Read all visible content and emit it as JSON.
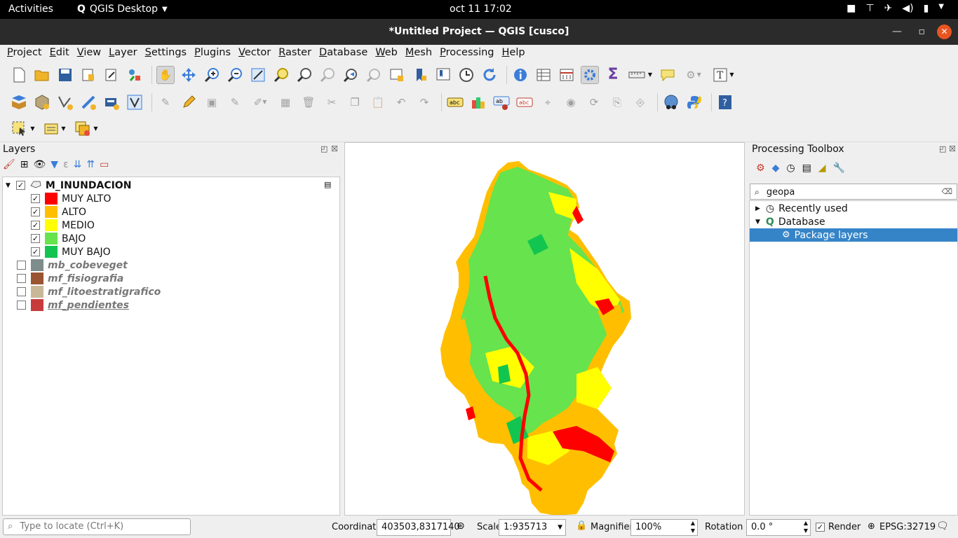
{
  "system": {
    "activities": "Activities",
    "app_name": "QGIS Desktop",
    "clock": "oct 11  17:02"
  },
  "window": {
    "title": "*Untitled Project — QGIS [cusco]"
  },
  "menu": [
    "Project",
    "Edit",
    "View",
    "Layer",
    "Settings",
    "Plugins",
    "Vector",
    "Raster",
    "Database",
    "Web",
    "Mesh",
    "Processing",
    "Help"
  ],
  "layers_panel": {
    "title": "Layers",
    "group": {
      "name": "M_INUNDACION",
      "checked": true
    },
    "classes": [
      {
        "label": "MUY ALTO",
        "color": "#ff0000"
      },
      {
        "label": "ALTO",
        "color": "#ffbf00"
      },
      {
        "label": "MEDIO",
        "color": "#ffff00"
      },
      {
        "label": "BAJO",
        "color": "#66e34d"
      },
      {
        "label": "MUY BAJO",
        "color": "#12c550"
      }
    ],
    "inactive_layers": [
      {
        "label": "mb_cobeveget",
        "color": "#7f8c8c"
      },
      {
        "label": "mf_fisiografia",
        "color": "#9a5432"
      },
      {
        "label": "mf_litoestratigrafico",
        "color": "#c9b898"
      },
      {
        "label": "mf_pendientes",
        "color": "#c83b3b"
      }
    ]
  },
  "processing": {
    "title": "Processing Toolbox",
    "search_value": "geopa",
    "tree": [
      {
        "label": "Recently used",
        "expanded": false
      },
      {
        "label": "Database",
        "expanded": true
      },
      {
        "label": "Package layers",
        "selected": true
      }
    ]
  },
  "status": {
    "locate_placeholder": "Type to locate (Ctrl+K)",
    "coordinate_label": "Coordinate",
    "coordinate_value": "403503,8317140",
    "scale_label": "Scale",
    "scale_value": "1:935713",
    "magnifier_label": "Magnifier",
    "magnifier_value": "100%",
    "rotation_label": "Rotation",
    "rotation_value": "0.0 °",
    "render_label": "Render",
    "render_checked": true,
    "crs": "EPSG:32719"
  },
  "colors": {
    "selection": "#3584c8",
    "accent_close": "#e95420"
  }
}
